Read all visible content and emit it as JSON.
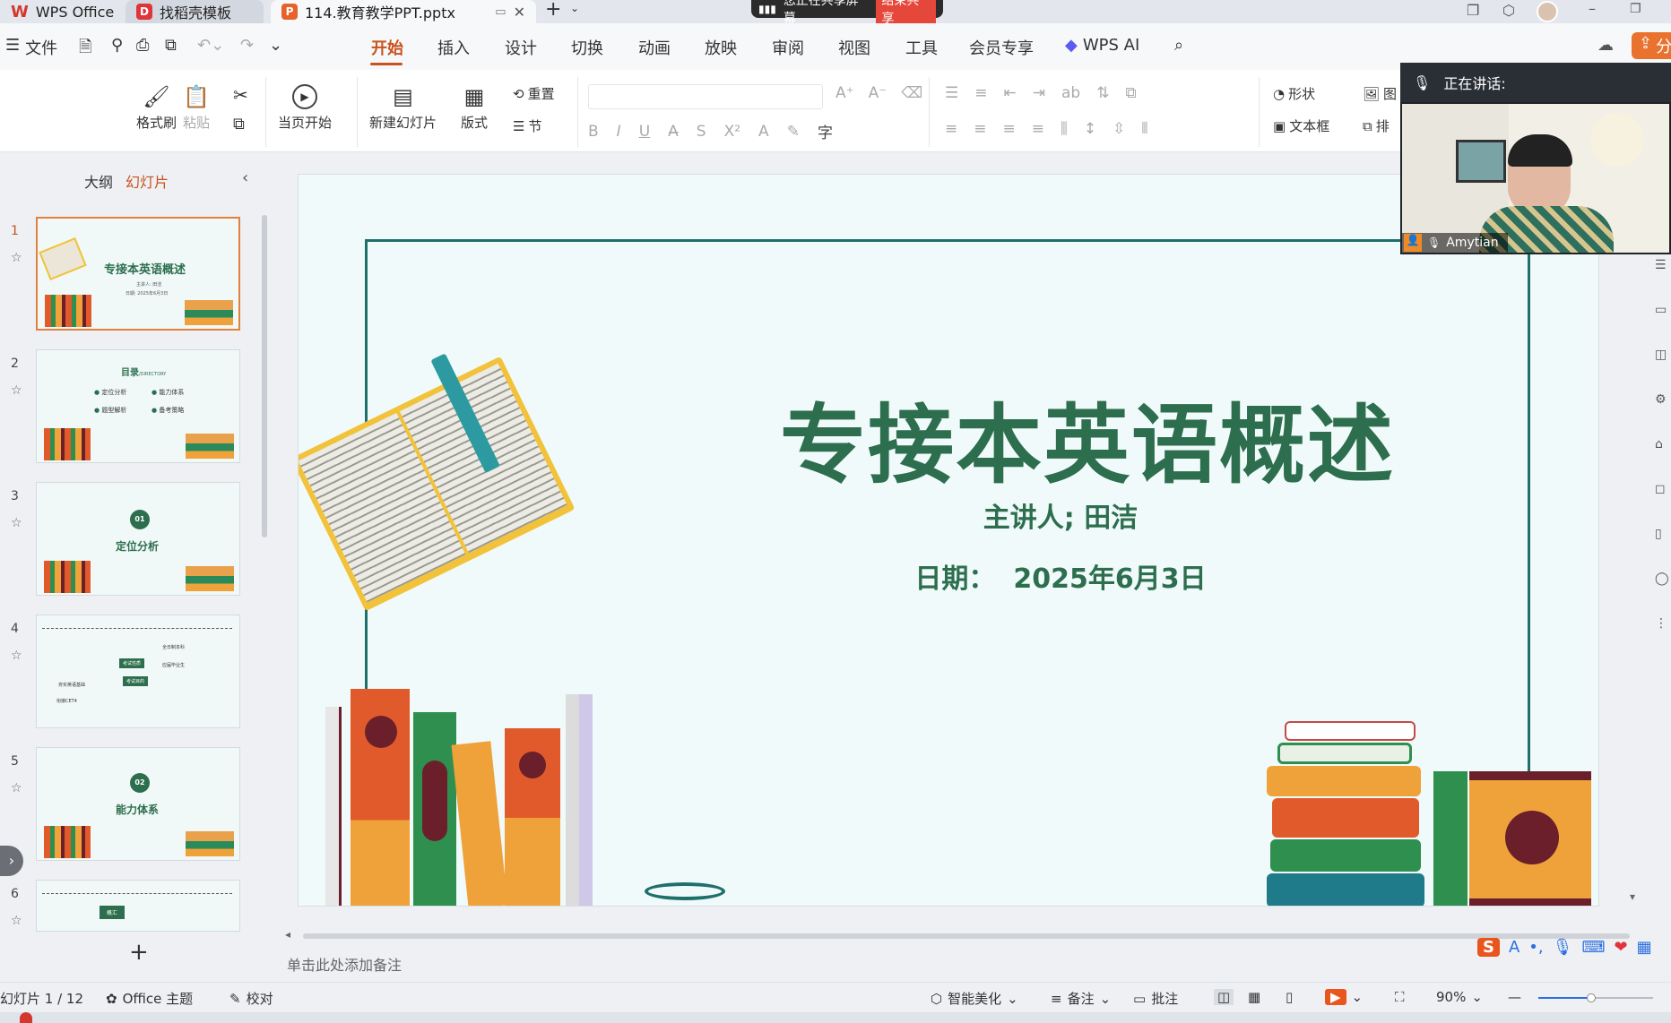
{
  "titlebar": {
    "app_tab": "WPS Office",
    "template_tab": "找稻壳模板",
    "doc_tab": "114.教育教学PPT.pptx",
    "share_text": "您正在共享屏幕",
    "share_stop": "结束共享"
  },
  "menu": {
    "file": "文件",
    "items": [
      "开始",
      "插入",
      "设计",
      "切换",
      "动画",
      "放映",
      "审阅",
      "视图",
      "工具",
      "会员专享",
      "WPS AI"
    ],
    "active": "开始",
    "share_label": "分"
  },
  "ribbon": {
    "format_painter": "格式刷",
    "paste": "粘贴",
    "start_from_current": "当页开始",
    "new_slide": "新建幻灯片",
    "layout": "版式",
    "reset": "重置",
    "section": "节",
    "shape": "形状",
    "textbox": "文本框",
    "picture": "图",
    "arrange": "排"
  },
  "leftpanel": {
    "outline_tab": "大纲",
    "slides_tab": "幻灯片",
    "thumbnails": [
      {
        "num": "1",
        "title": "专接本英语概述",
        "sub1": "主讲人: 田洁",
        "sub2": "日期: 2025年6月3日"
      },
      {
        "num": "2",
        "title": "目录",
        "title_en": "/DIRECTORY",
        "items": [
          "定位分析",
          "能力体系",
          "题型解析",
          "备考策略"
        ]
      },
      {
        "num": "3",
        "badge": "01",
        "title": "定位分析"
      },
      {
        "num": "4",
        "labels": [
          "考试性质",
          "考试目的",
          "全日制本科",
          "应届毕业生",
          "夯实英语基础",
          "衔接CET4"
        ]
      },
      {
        "num": "5",
        "badge": "02",
        "title": "能力体系"
      },
      {
        "num": "6",
        "label": "概汇"
      }
    ]
  },
  "slide": {
    "title": "专接本英语概述",
    "presenter": "主讲人; 田洁",
    "date_label": "日期：",
    "date_value": "2025年6月3日"
  },
  "video": {
    "speaking_label": "正在讲话:",
    "participant_name": "Amytian"
  },
  "notes": {
    "placeholder": "单击此处添加备注"
  },
  "status": {
    "slide_counter": "幻灯片 1 / 12",
    "theme": "Office 主题",
    "proofread": "校对",
    "smart_beautify": "智能美化",
    "notes": "备注",
    "comments": "批注",
    "zoom": "90%"
  },
  "colors": {
    "accent": "#c8531c",
    "slide_green": "#2d6e4e",
    "frame_teal": "#1f6f6a",
    "slide_bg": "#f0fafa"
  }
}
